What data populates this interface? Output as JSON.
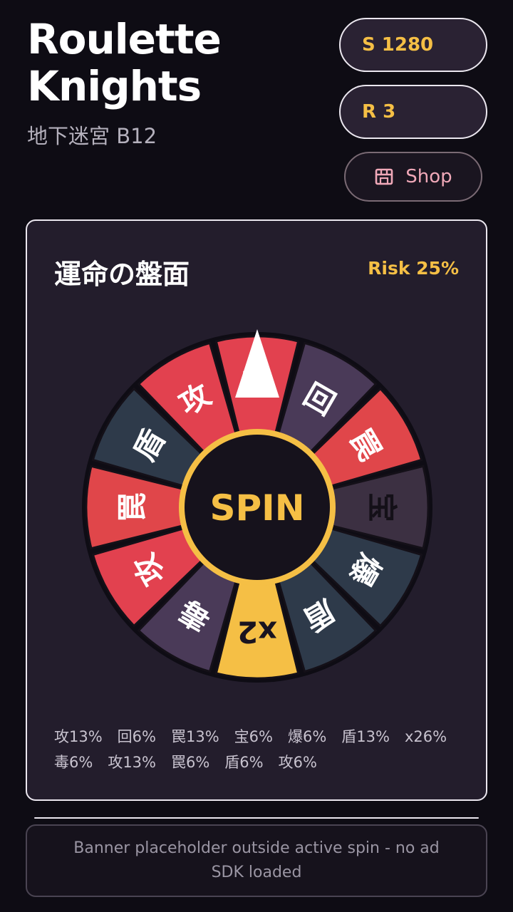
{
  "header": {
    "title_line1": "Roulette",
    "title_line2": "Knights",
    "subtitle": "地下迷宮 B12"
  },
  "stats": {
    "coins": "S 1280",
    "rerolls": "R 3",
    "shop_label": "Shop",
    "shop_icon": "shop-icon"
  },
  "board": {
    "title": "運命の盤面",
    "risk": "Risk 25%",
    "spin_label": "SPIN",
    "odds_text": "攻13%　回6%　罠13%　宝6%　爆6%　盾13%　x26%　毒6%　攻13%　罠6%　盾6%　攻6%"
  },
  "wheel": {
    "segments": [
      {
        "label": "攻",
        "color": "#e2414f"
      },
      {
        "label": "回",
        "color": "#4a3a58"
      },
      {
        "label": "罠",
        "color": "#e0464a"
      },
      {
        "label": "宝",
        "color": "#3c3042"
      },
      {
        "label": "爆",
        "color": "#2e3a4a"
      },
      {
        "label": "盾",
        "color": "#2e3a4a"
      },
      {
        "label": "x2",
        "color": "#f5bf45"
      },
      {
        "label": "毒",
        "color": "#4a3a58"
      },
      {
        "label": "攻",
        "color": "#e2414f"
      },
      {
        "label": "罠",
        "color": "#e0464a"
      },
      {
        "label": "盾",
        "color": "#2e3a4a"
      },
      {
        "label": "攻",
        "color": "#e2414f"
      }
    ],
    "pointer_icon": "pointer-icon"
  },
  "banner": {
    "text": "Banner placeholder outside active spin - no ad SDK loaded"
  },
  "colors": {
    "accent": "#f5bf45",
    "background": "#0e0c14",
    "panel": "#231d2c"
  }
}
